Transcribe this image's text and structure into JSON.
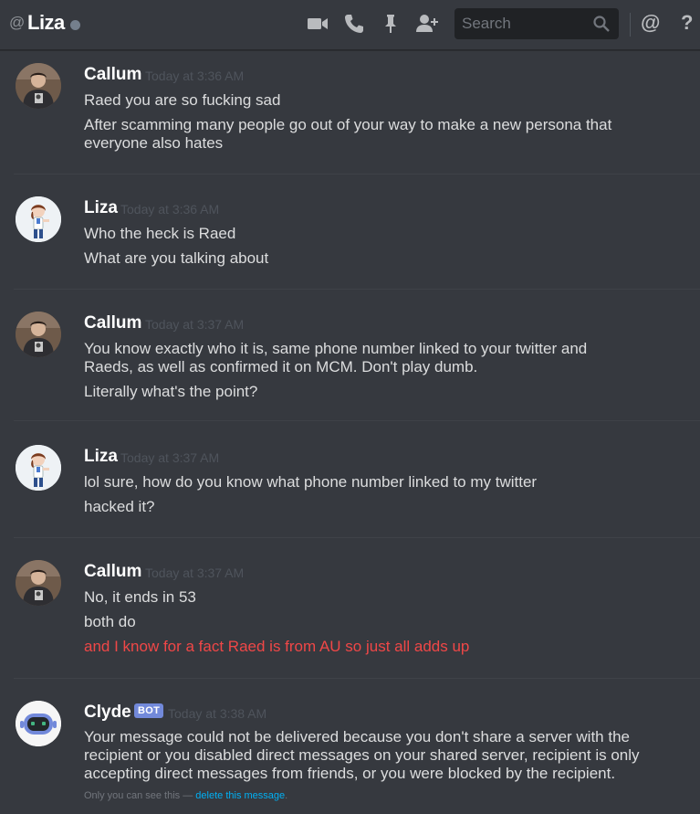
{
  "header": {
    "at_symbol": "@",
    "channel_name": "Liza",
    "search_placeholder": "Search",
    "icons": [
      "video-call-icon",
      "voice-call-icon",
      "pin-icon",
      "add-friend-icon",
      "search-icon",
      "mention-icon",
      "help-icon"
    ],
    "mention_glyph": "@",
    "help_glyph": "?"
  },
  "colors": {
    "background": "#36393f",
    "search_bg": "#202225",
    "bot_tag": "#7289da",
    "red_text": "#f04747",
    "link": "#00b0f4",
    "status_offline": "#747f8d"
  },
  "messages": [
    {
      "author": "Callum",
      "timestamp": "Today at 3:36 AM",
      "lines": [
        "Raed you are so fucking sad",
        "After scamming many people go out of your way to make a new persona that everyone also hates"
      ]
    },
    {
      "author": "Liza",
      "timestamp": "Today at 3:36 AM",
      "lines": [
        "Who the heck is Raed",
        "What are you talking about"
      ]
    },
    {
      "author": "Callum",
      "timestamp": "Today at 3:37 AM",
      "lines": [
        "You know exactly who it is, same phone number linked to your twitter and Raeds, as well as confirmed it on MCM. Don't play dumb.",
        "Literally what's the point?"
      ]
    },
    {
      "author": "Liza",
      "timestamp": "Today at 3:37 AM",
      "lines": [
        "lol sure, how do you know what phone number linked to my twitter",
        "hacked it?"
      ]
    },
    {
      "author": "Callum",
      "timestamp": "Today at 3:37 AM",
      "lines": [
        "No, it ends in 53",
        "both do",
        "and I know for a fact Raed is from AU so just all adds up"
      ]
    },
    {
      "author": "Clyde",
      "bot_tag": "BOT",
      "timestamp": "Today at 3:38 AM",
      "lines": [
        "Your message could not be delivered because you don't share a server with the recipient or you disabled direct messages on your shared server, recipient is only accepting direct messages from friends, or you were blocked by the recipient."
      ],
      "ephemeral_note": "Only you can see this —",
      "delete_link": "delete this message",
      "ephemeral_end": "."
    }
  ]
}
